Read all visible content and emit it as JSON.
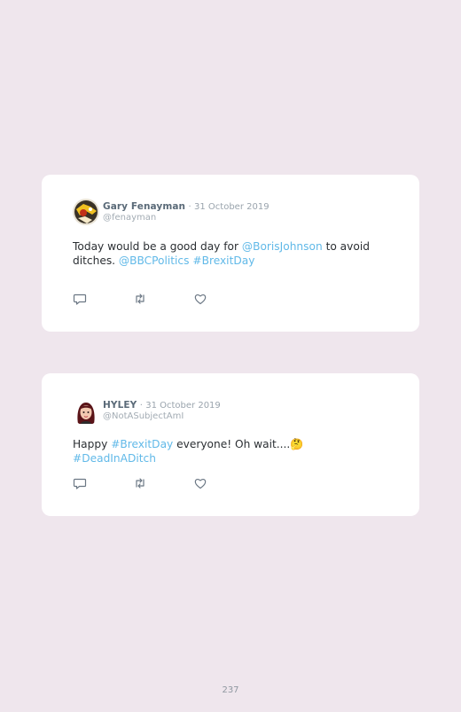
{
  "tweets": [
    {
      "name": "Gary Fenayman",
      "separator": "·",
      "date": "31 October 2019",
      "handle": "@fenayman",
      "text_parts": [
        "Today would be a good day for ",
        "@BorisJohnson",
        " to avoid ditches. ",
        "@BBCPolitics",
        " ",
        "#BrexitDay"
      ]
    },
    {
      "name": "HYLEY",
      "separator": "·",
      "date": "31 October 2019",
      "handle": "@NotASubjectAmI",
      "text_parts": [
        "Happy ",
        "#BrexitDay",
        " everyone! Oh wait....",
        "🤔",
        " ",
        "#DeadInADitch"
      ]
    }
  ],
  "icons": {
    "reply": "reply-icon",
    "retweet": "retweet-icon",
    "like": "heart-icon"
  },
  "colors": {
    "background": "#efe6ed",
    "card": "#ffffff",
    "link": "#61b9e8",
    "name": "#5a6a78"
  },
  "page_number": "237"
}
